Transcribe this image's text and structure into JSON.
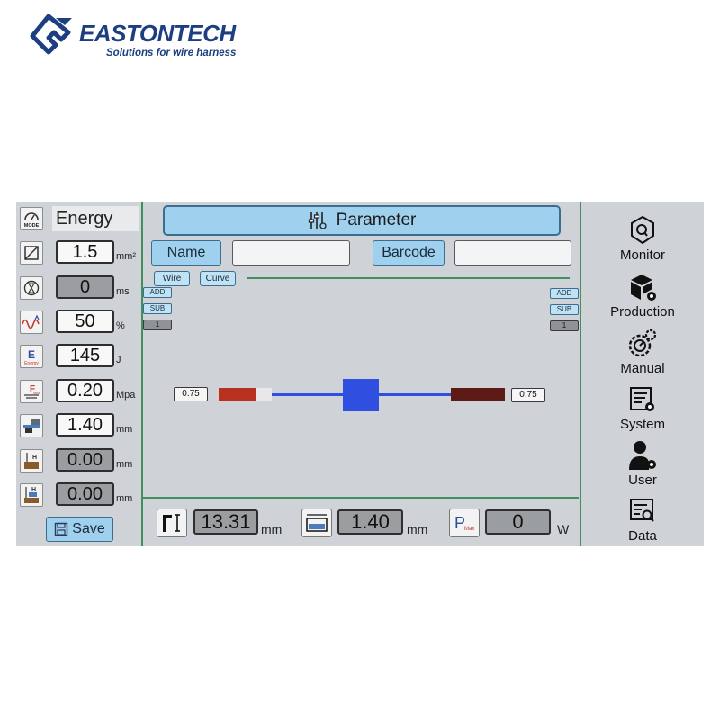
{
  "brand": {
    "name": "EASTONTECH",
    "tagline": "Solutions for wire harness"
  },
  "mode": {
    "value": "Energy"
  },
  "params": [
    {
      "value": "1.5",
      "unit": "mm²",
      "readonly": false
    },
    {
      "value": "0",
      "unit": "ms",
      "readonly": true
    },
    {
      "value": "50",
      "unit": "%",
      "readonly": false
    },
    {
      "value": "145",
      "unit": "J",
      "readonly": false
    },
    {
      "value": "0.20",
      "unit": "Mpa",
      "readonly": false
    },
    {
      "value": "1.40",
      "unit": "mm",
      "readonly": false
    },
    {
      "value": "0.00",
      "unit": "mm",
      "readonly": true
    },
    {
      "value": "0.00",
      "unit": "mm",
      "readonly": true
    }
  ],
  "save_label": "Save",
  "header": {
    "title": "Parameter",
    "name_label": "Name",
    "name_value": "",
    "barcode_label": "Barcode",
    "barcode_value": ""
  },
  "tabs": {
    "wire": "Wire",
    "curve": "Curve"
  },
  "left_side": {
    "add": "ADD",
    "sub": "SUB",
    "count": "1",
    "wire_size": "0.75"
  },
  "right_side": {
    "add": "ADD",
    "sub": "SUB",
    "count": "1",
    "wire_size": "0.75"
  },
  "bottom": {
    "height_value": "13.31",
    "height_unit": "mm",
    "width_value": "1.40",
    "width_unit": "mm",
    "power_value": "0",
    "power_unit": "W",
    "power_icon_text": "P",
    "power_icon_sub": "Max"
  },
  "icons": {
    "mode_text": "MODE",
    "energy_letter": "E",
    "energy_sub": "Energy",
    "pressure_letter": "F",
    "pressure_sub": "Mpa",
    "h_letter": "H"
  },
  "nav": [
    {
      "label": "Monitor",
      "icon": "monitor-shield-icon"
    },
    {
      "label": "Production",
      "icon": "production-box-icon"
    },
    {
      "label": "Manual",
      "icon": "manual-gears-icon"
    },
    {
      "label": "System",
      "icon": "system-settings-icon"
    },
    {
      "label": "User",
      "icon": "user-icon"
    },
    {
      "label": "Data",
      "icon": "data-search-icon"
    }
  ],
  "colors": {
    "accent": "#9fd0ee",
    "divider": "#3f8f5f",
    "screen_bg": "#cfd3d7",
    "wire_line": "#2f4fe0",
    "weld_block": "#2f4fe0",
    "left_terminal": "#b8301f",
    "right_terminal": "#5e1a14",
    "brand": "#1d3f82"
  }
}
